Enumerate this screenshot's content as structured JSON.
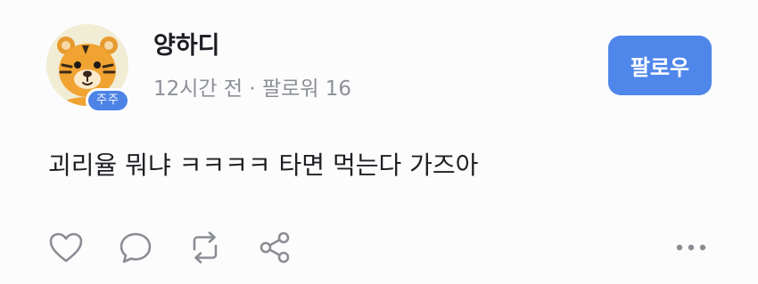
{
  "user": {
    "name": "양하디",
    "badge": "주주",
    "avatar": "tiger-avatar"
  },
  "meta": {
    "time": "12시간 전",
    "separator": "·",
    "followers": "팔로워 16"
  },
  "follow_button": {
    "label": "팔로우",
    "color": "#4f86ea"
  },
  "post": {
    "text": "괴리율 뭐냐 ㅋㅋㅋㅋ 타면 먹는다 가즈아"
  },
  "actions": [
    {
      "icon": "heart-icon"
    },
    {
      "icon": "comment-icon"
    },
    {
      "icon": "repost-icon"
    },
    {
      "icon": "share-icon"
    },
    {
      "icon": "more-icon"
    }
  ]
}
